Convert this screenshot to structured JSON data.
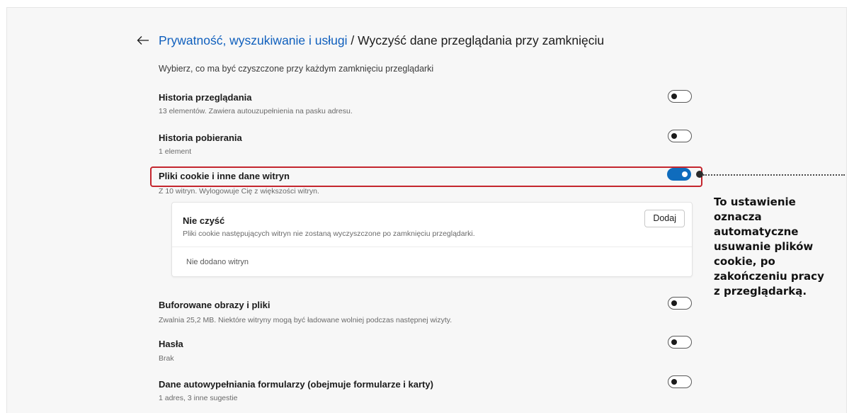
{
  "header": {
    "back_icon": "arrow-left-icon",
    "breadcrumb_link": "Prywatność, wyszukiwanie i usługi",
    "separator": " / ",
    "current": "Wyczyść dane przeglądania przy zamknięciu"
  },
  "intro": "Wybierz, co ma być czyszczone przy każdym zamknięciu przeglądarki",
  "items": [
    {
      "title": "Historia przeglądania",
      "description": "13 elementów. Zawiera autouzupełnienia na pasku adresu.",
      "enabled": false
    },
    {
      "title": "Historia pobierania",
      "description": "1 element",
      "enabled": false
    },
    {
      "title": "Pliki cookie i inne dane witryn",
      "description": "Z 10 witryn. Wylogowuje Cię z większości witryn.",
      "enabled": true
    },
    {
      "title": "Buforowane obrazy i pliki",
      "description": "Zwalnia 25,2 MB. Niektóre witryny mogą być ładowane wolniej podczas następnej wizyty.",
      "enabled": false
    },
    {
      "title": "Hasła",
      "description": "Brak",
      "enabled": false
    },
    {
      "title": "Dane autowypełniania formularzy (obejmuje formularze i karty)",
      "description": "1 adres, 3 inne sugestie",
      "enabled": false
    }
  ],
  "exceptions": {
    "title": "Nie czyść",
    "description": "Pliki cookie następujących witryn nie zostaną wyczyszczone po zamknięciu przeglądarki.",
    "add_label": "Dodaj",
    "empty": "Nie dodano witryn"
  },
  "annotation": {
    "lines": [
      "To ustawienie",
      "oznacza",
      "automatyczne",
      "usuwanie plików",
      "cookie, po",
      "zakończeniu pracy",
      "z przeglądarką."
    ]
  },
  "colors": {
    "accent": "#0f6cbd",
    "link": "#0f5fbd",
    "highlight": "#c4262e"
  }
}
